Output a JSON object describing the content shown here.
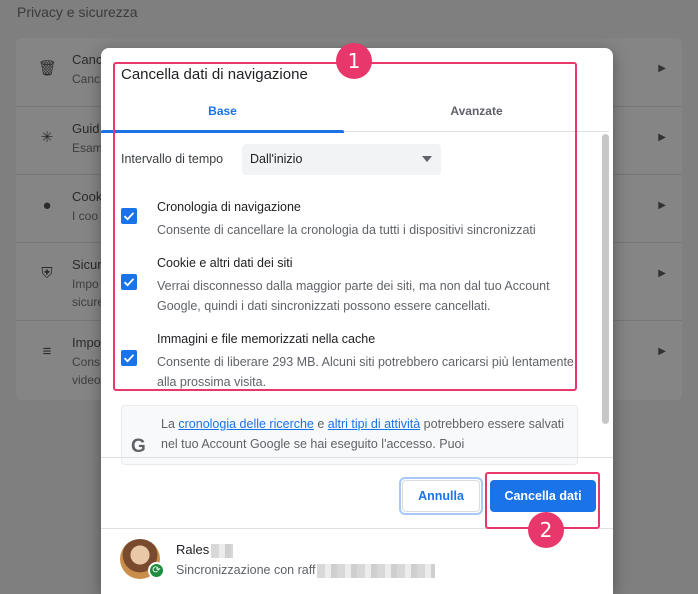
{
  "background": {
    "section_title": "Privacy e sicurezza",
    "rows": [
      {
        "icon": "trash-icon",
        "title": "Canc",
        "subtitle": "Canc"
      },
      {
        "icon": "compass-icon",
        "title": "Guid",
        "subtitle": "Esam"
      },
      {
        "icon": "cookie-icon",
        "title": "Cook",
        "subtitle": "I coo"
      },
      {
        "icon": "shield-icon",
        "title": "Sicur",
        "subtitle": "Impo"
      },
      {
        "icon": "sliders-icon",
        "title": "Impo",
        "subtitle": "Cons"
      }
    ],
    "extra_lines": [
      "sicurez",
      "video"
    ]
  },
  "dialog": {
    "title": "Cancella dati di navigazione",
    "tabs": [
      {
        "label": "Base",
        "active": true
      },
      {
        "label": "Avanzate",
        "active": false
      }
    ],
    "time_range": {
      "label": "Intervallo di tempo",
      "selected": "Dall'inizio"
    },
    "options": [
      {
        "title": "Cronologia di navigazione",
        "description": "Consente di cancellare la cronologia da tutti i dispositivi sincronizzati",
        "checked": true
      },
      {
        "title": "Cookie e altri dati dei siti",
        "description": "Verrai disconnesso dalla maggior parte dei siti, ma non dal tuo Account Google, quindi i dati sincronizzati possono essere cancellati.",
        "checked": true
      },
      {
        "title": "Immagini e file memorizzati nella cache",
        "description": "Consente di liberare 293 MB. Alcuni siti potrebbero caricarsi più lentamente alla prossima visita.",
        "checked": true
      }
    ],
    "info": {
      "prefix": "La ",
      "link1": "cronologia delle ricerche",
      "middle": " e ",
      "link2": "altri tipi di attività",
      "suffix": " potrebbero essere salvati nel tuo Account Google se hai eseguito l'accesso. Puoi"
    },
    "buttons": {
      "cancel": "Annulla",
      "clear": "Cancella dati"
    },
    "account": {
      "name": "Rales",
      "sync_text": "Sincronizzazione con raff"
    }
  },
  "annotations": {
    "marker1": "1",
    "marker2": "2",
    "color": "#e8386b"
  },
  "colors": {
    "accent": "#1a73e8",
    "annotation": "#e8386b"
  }
}
